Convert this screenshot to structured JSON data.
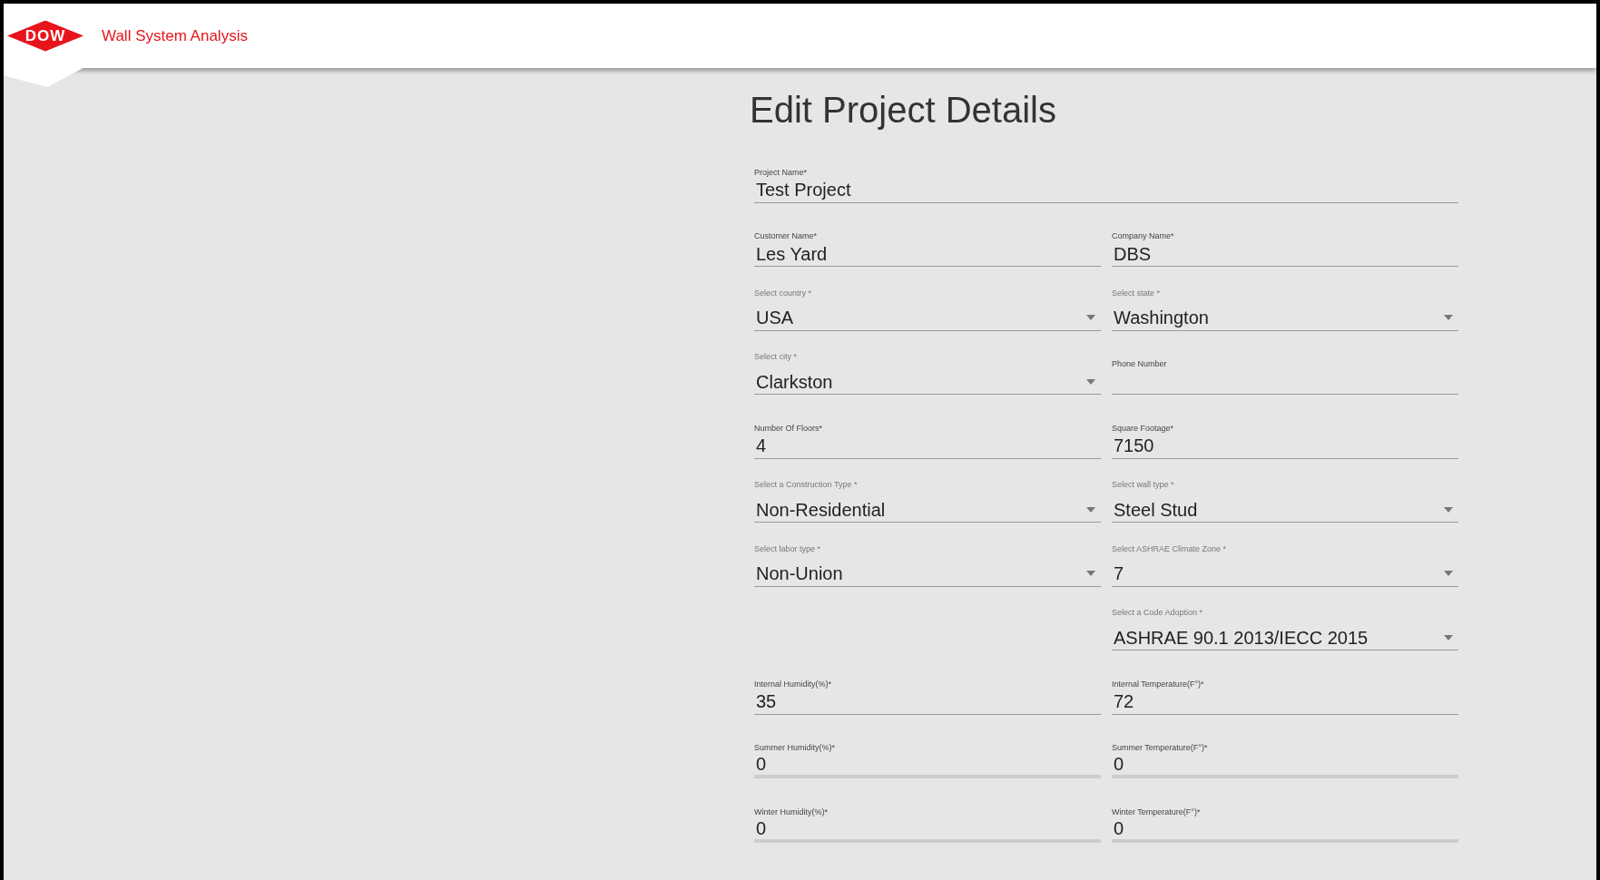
{
  "header": {
    "logo": "DOW",
    "app_title": "Wall System Analysis"
  },
  "page_title": "Edit Project Details",
  "full_row": {
    "kind": "text",
    "label": "Project Name*",
    "value": "Test Project",
    "disabled": false
  },
  "rows": [
    {
      "left": {
        "kind": "text",
        "label": "Customer Name*",
        "value": "Les Yard",
        "disabled": false
      },
      "right": {
        "kind": "text",
        "label": "Company Name*",
        "value": "DBS",
        "disabled": false
      }
    },
    {
      "left": {
        "kind": "select",
        "label": "Select country *",
        "value": "USA",
        "disabled": false
      },
      "right": {
        "kind": "select",
        "label": "Select state *",
        "value": "Washington",
        "disabled": false
      }
    },
    {
      "left": {
        "kind": "select",
        "label": "Select city *",
        "value": "Clarkston",
        "disabled": false
      },
      "right": {
        "kind": "text",
        "label": "Phone Number",
        "disabled": false
      }
    },
    {
      "left": {
        "kind": "text",
        "label": "Number Of Floors*",
        "value": "4",
        "disabled": false
      },
      "right": {
        "kind": "text",
        "label": "Square Footage*",
        "value": "7150",
        "disabled": false
      }
    },
    {
      "left": {
        "kind": "select",
        "label": "Select a Construction Type *",
        "value": "Non-Residential",
        "disabled": false
      },
      "right": {
        "kind": "select",
        "label": "Select wall type *",
        "value": "Steel Stud",
        "disabled": false
      }
    },
    {
      "left": {
        "kind": "select",
        "label": "Select labor type *",
        "value": "Non-Union",
        "disabled": false
      },
      "right": {
        "kind": "select",
        "label": "Select ASHRAE Climate Zone *",
        "value": "7",
        "disabled": false
      }
    },
    {
      "right": {
        "kind": "select",
        "label": "Select a Code Adoption *",
        "value": "ASHRAE 90.1 2013/IECC 2015",
        "disabled": false
      }
    },
    {
      "left": {
        "kind": "text",
        "label": "Internal Humidity(%)*",
        "value": "35",
        "disabled": false
      },
      "right": {
        "kind": "text",
        "label": "Internal Temperature(F°)*",
        "value": "72",
        "disabled": false
      }
    },
    {
      "left": {
        "kind": "text",
        "label": "Summer Humidity(%)*",
        "value": "0",
        "disabled": true
      },
      "right": {
        "kind": "text",
        "label": "Summer Temperature(F°)*",
        "value": "0",
        "disabled": true
      }
    },
    {
      "left": {
        "kind": "text",
        "label": "Winter Humidity(%)*",
        "value": "0",
        "disabled": true
      },
      "right": {
        "kind": "text",
        "label": "Winter Temperature(F°)*",
        "value": "0",
        "disabled": true
      }
    }
  ]
}
